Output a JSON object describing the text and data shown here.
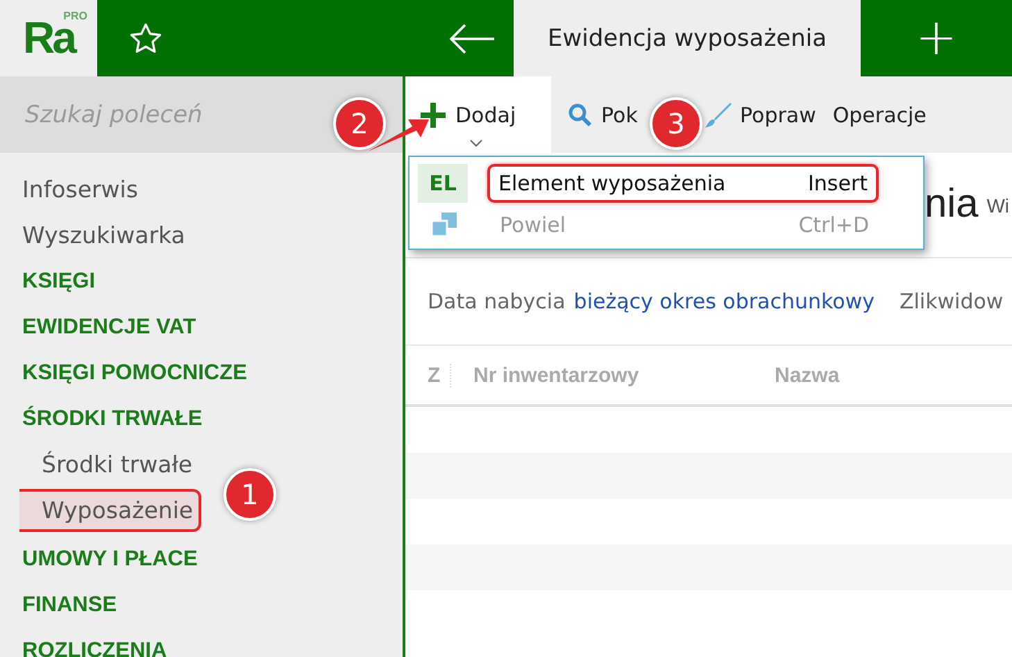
{
  "logo": {
    "text": "Ra",
    "badge": "PRO"
  },
  "tabs": [
    {
      "label": "Ewidencja wyposażenia",
      "selected": true
    }
  ],
  "new_tab": "+",
  "search": {
    "placeholder": "Szukaj poleceń"
  },
  "sidebar": {
    "items": [
      {
        "label": "Infoserwis",
        "kind": "link",
        "selected": false
      },
      {
        "label": "Wyszukiwarka",
        "kind": "link",
        "selected": false
      },
      {
        "label": "KSIĘGI",
        "kind": "section",
        "selected": false
      },
      {
        "label": "EWIDENCJE VAT",
        "kind": "section",
        "selected": false
      },
      {
        "label": "KSIĘGI POMOCNICZE",
        "kind": "section",
        "selected": false
      },
      {
        "label": "ŚRODKI TRWAŁE",
        "kind": "section",
        "selected": false,
        "children": [
          {
            "label": "Środki trwałe",
            "selected": false
          },
          {
            "label": "Wyposażenie",
            "selected": true
          }
        ]
      },
      {
        "label": "UMOWY I PŁACE",
        "kind": "section",
        "selected": false
      },
      {
        "label": "FINANSE",
        "kind": "section",
        "selected": false
      },
      {
        "label": "ROZLICZENIA",
        "kind": "section",
        "selected": false
      }
    ]
  },
  "toolbar": [
    {
      "label": "Dodaj",
      "kind": "add"
    },
    {
      "label": "Pok",
      "kind": "show"
    },
    {
      "label": "Popraw",
      "kind": "edit"
    },
    {
      "label": "Operacje",
      "kind": "plain"
    }
  ],
  "menu": [
    {
      "tag": "EL",
      "label": "Element wyposażenia",
      "shortcut": "Insert",
      "disabled": false,
      "highlighted": true
    },
    {
      "label": "Powiel",
      "shortcut": "Ctrl+D",
      "disabled": true,
      "highlighted": false
    }
  ],
  "title_visible": "nia",
  "title_note": "Wi",
  "filter": {
    "label": "Data nabycia",
    "value": "bieżący okres obrachunkowy",
    "next": "Zlikwidow"
  },
  "table": {
    "columns": [
      "Z",
      "Nr inwentarzowy",
      "Nazwa"
    ]
  },
  "callouts": [
    "1",
    "2",
    "3"
  ]
}
